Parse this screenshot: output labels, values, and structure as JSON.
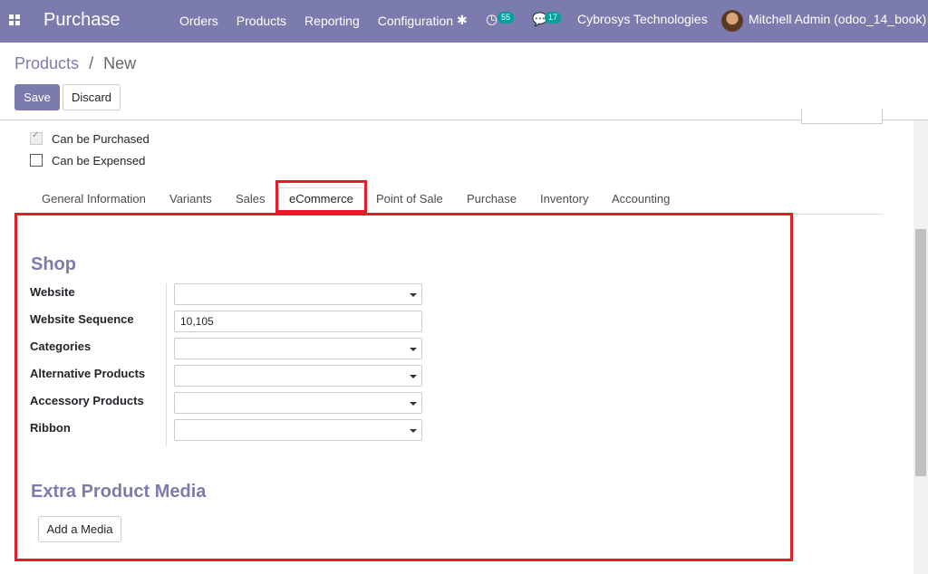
{
  "navbar": {
    "app_title": "Purchase",
    "menu": [
      "Orders",
      "Products",
      "Reporting",
      "Configuration"
    ],
    "activity_count": "55",
    "message_count": "17",
    "company": "Cybrosys Technologies",
    "user": "Mitchell Admin (odoo_14_book)",
    "colors": {
      "bar": "#7c7bad",
      "badge": "#00a09d"
    }
  },
  "breadcrumb": {
    "parent": "Products",
    "separator": "/",
    "current": "New"
  },
  "actions": {
    "save": "Save",
    "discard": "Discard"
  },
  "options": [
    {
      "label": "Can be Purchased",
      "checked": true
    },
    {
      "label": "Can be Expensed",
      "checked": false
    }
  ],
  "tabs": [
    "General Information",
    "Variants",
    "Sales",
    "eCommerce",
    "Point of Sale",
    "Purchase",
    "Inventory",
    "Accounting"
  ],
  "active_tab": "eCommerce",
  "shop": {
    "title": "Shop",
    "fields": [
      {
        "label": "Website",
        "value": "",
        "type": "select"
      },
      {
        "label": "Website Sequence",
        "value": "10,105",
        "type": "input"
      },
      {
        "label": "Categories",
        "value": "",
        "type": "select"
      },
      {
        "label": "Alternative Products",
        "value": "",
        "type": "select"
      },
      {
        "label": "Accessory Products",
        "value": "",
        "type": "select"
      },
      {
        "label": "Ribbon",
        "value": "",
        "type": "select"
      }
    ]
  },
  "media": {
    "title": "Extra Product Media",
    "button": "Add a Media"
  },
  "highlight_color": "#e31d2b"
}
